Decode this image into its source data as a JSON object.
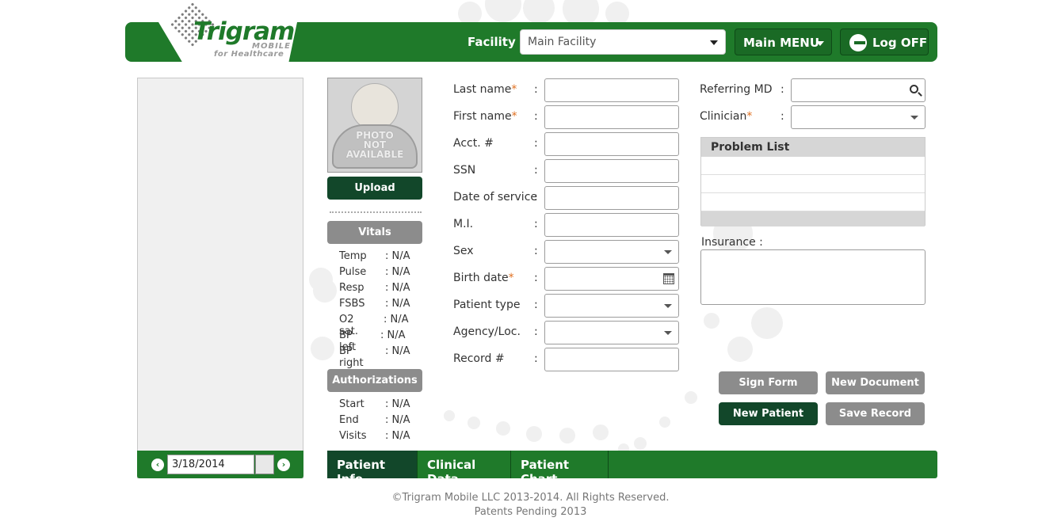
{
  "header": {
    "logo_word": "Trigram",
    "logo_mobile": "MOBILE",
    "logo_tagline": "for Healthcare",
    "facility_label": "Facility",
    "facility_value": "Main Facility",
    "main_menu_label": "Main MENU",
    "logoff_label": "Log OFF"
  },
  "calendar": {
    "date": "3/18/2014",
    "prev": "‹",
    "next": "›"
  },
  "photo": {
    "text_line1": "PHOTO",
    "text_line2": "NOT",
    "text_line3": "AVAILABLE",
    "upload_label": "Upload"
  },
  "vitals": {
    "title": "Vitals",
    "items": [
      {
        "label": "Temp",
        "value": ": N/A"
      },
      {
        "label": "Pulse",
        "value": ": N/A"
      },
      {
        "label": "Resp",
        "value": ": N/A"
      },
      {
        "label": "FSBS",
        "value": ": N/A"
      },
      {
        "label": "O2 sat.",
        "value": ": N/A"
      },
      {
        "label": "BP left",
        "value": ": N/A"
      },
      {
        "label": "BP right",
        "value": ": N/A"
      }
    ]
  },
  "authorizations": {
    "title": "Authorizations",
    "items": [
      {
        "label": "Start",
        "value": ": N/A"
      },
      {
        "label": "End",
        "value": ": N/A"
      },
      {
        "label": "Visits",
        "value": ": N/A"
      }
    ]
  },
  "form": {
    "colon": ":",
    "required_mark": "*",
    "fields": [
      {
        "label": "Last name",
        "value": ""
      },
      {
        "label": "First name",
        "value": ""
      },
      {
        "label": "Acct. #",
        "value": ""
      },
      {
        "label": "SSN",
        "value": ""
      },
      {
        "label": "Date of service",
        "value": ""
      },
      {
        "label": "M.I.",
        "value": ""
      },
      {
        "label": "Sex",
        "value": ""
      },
      {
        "label": "Birth date",
        "value": ""
      },
      {
        "label": "Patient type",
        "value": ""
      },
      {
        "label": "Agency/Loc.",
        "value": ""
      },
      {
        "label": "Record #",
        "value": ""
      }
    ]
  },
  "right": {
    "referring_label": "Referring MD",
    "clinician_label": "Clinician",
    "problem_list_title": "Problem List",
    "insurance_label": "Insurance :",
    "sign_form_label": "Sign Form",
    "new_document_label": "New Document",
    "new_patient_label": "New Patient",
    "save_record_label": "Save Record"
  },
  "tabs": [
    {
      "label": "Patient Info"
    },
    {
      "label": "Clinical Data"
    },
    {
      "label": "Patient Chart"
    }
  ],
  "footer": {
    "copyright": "©Trigram Mobile LLC 2013-2014. All Rights Reserved.",
    "patents": "Patents Pending 2013"
  }
}
